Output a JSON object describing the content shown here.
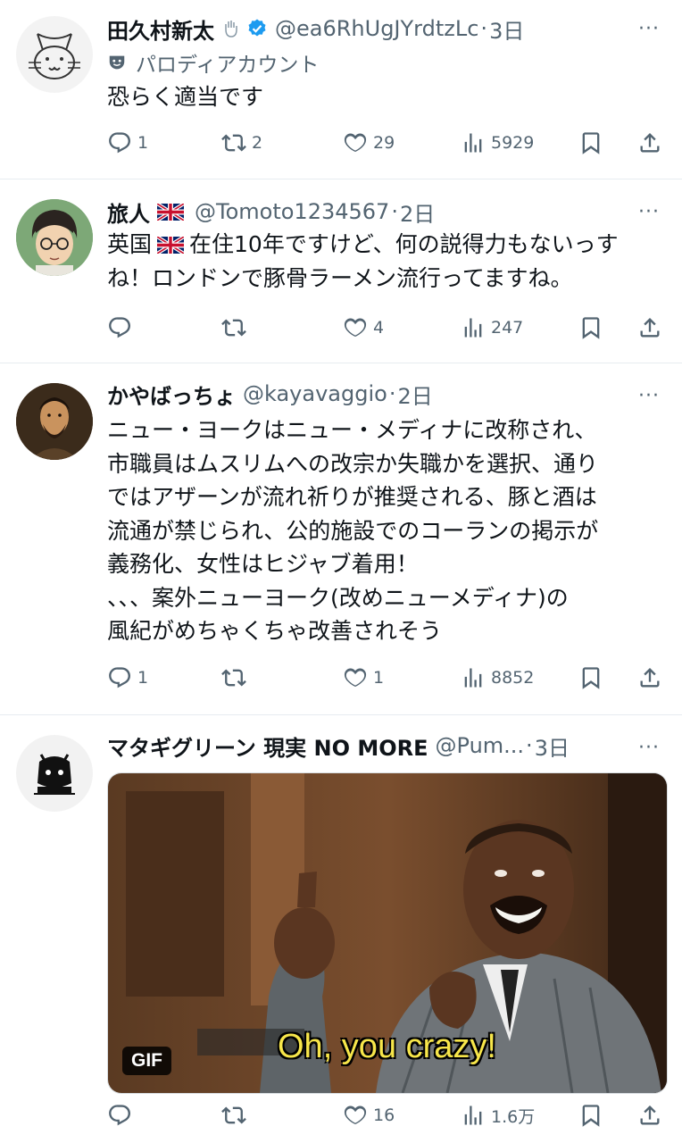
{
  "tweets": [
    {
      "name": "田久村新太",
      "handle": "@ea6RhUgJYrdtzLc",
      "time": "3日",
      "label": "パロディアカウント",
      "text": "恐らく適当です",
      "replies": "1",
      "reposts": "2",
      "likes": "29",
      "views": "5929"
    },
    {
      "name": "旅人",
      "handle": "@Tomoto1234567",
      "time": "2日",
      "text_line1_a": "英国",
      "text_line1_b": "在住10年ですけど、何の説得力もないっす",
      "text_line2": "ね！ロンドンで豚骨ラーメン流行ってますね。",
      "replies": "",
      "reposts": "",
      "likes": "4",
      "views": "247"
    },
    {
      "name": "かやばっちょ",
      "handle": "@kayavaggio",
      "time": "2日",
      "text": "ニュー・ヨークはニュー・メディナに改称され、\n市職員はムスリムへの改宗か失職かを選択、通り\nではアザーンが流れ祈りが推奨される、豚と酒は\n流通が禁じられ、公的施設でのコーランの掲示が\n義務化、女性はヒジャブ着用！\n、、、案外ニューヨーク(改めニューメディナ)の\n風紀がめちゃくちゃ改善されそう",
      "replies": "1",
      "reposts": "",
      "likes": "1",
      "views": "8852"
    },
    {
      "name": "マタギグリーン 現実 NO MORE",
      "handle": "@Pum...",
      "time": "3日",
      "gif_badge": "GIF",
      "gif_caption": "Oh, you crazy!",
      "replies": "",
      "reposts": "",
      "likes": "16",
      "views": "1.6万"
    }
  ],
  "separator": "·",
  "more_glyph": "···",
  "colors": {
    "text": "#0f1419",
    "muted": "#536471",
    "verified": "#1d9bf0",
    "divider": "#e6ecf0"
  },
  "icons": [
    "reply-icon",
    "repost-icon",
    "like-icon",
    "views-icon",
    "bookmark-icon",
    "share-icon",
    "verified-badge-icon",
    "parody-mask-icon",
    "uk-flag-icon"
  ]
}
